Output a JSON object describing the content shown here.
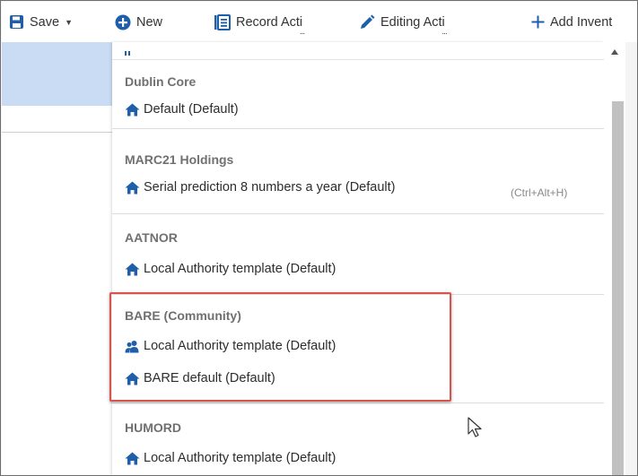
{
  "toolbar": {
    "save_label": "Save",
    "new_label": "New",
    "record_label": "Record Acti",
    "editing_label": "Editing Acti",
    "add_label": "Add Invent"
  },
  "menu": {
    "groups": [
      {
        "title": "Dublin Core",
        "items": [
          {
            "label": "Default (Default)",
            "icon": "home-icon"
          }
        ]
      },
      {
        "title": "MARC21 Holdings",
        "items": [
          {
            "label": "Serial prediction 8 numbers a year (Default)",
            "icon": "home-icon",
            "shortcut": "(Ctrl+Alt+H)"
          }
        ]
      },
      {
        "title": "AATNOR",
        "items": [
          {
            "label": "Local Authority template (Default)",
            "icon": "home-icon"
          }
        ]
      },
      {
        "title": "BARE (Community)",
        "items": [
          {
            "label": "Local Authority template (Default)",
            "icon": "community-icon"
          },
          {
            "label": "BARE default (Default)",
            "icon": "home-icon"
          }
        ]
      },
      {
        "title": "HUMORD",
        "items": [
          {
            "label": "Local Authority template (Default)",
            "icon": "home-icon"
          }
        ]
      }
    ]
  },
  "colors": {
    "accent_blue": "#1f5ea8",
    "highlight_red": "#d9534f",
    "selected_row": "#c9dcf3"
  }
}
